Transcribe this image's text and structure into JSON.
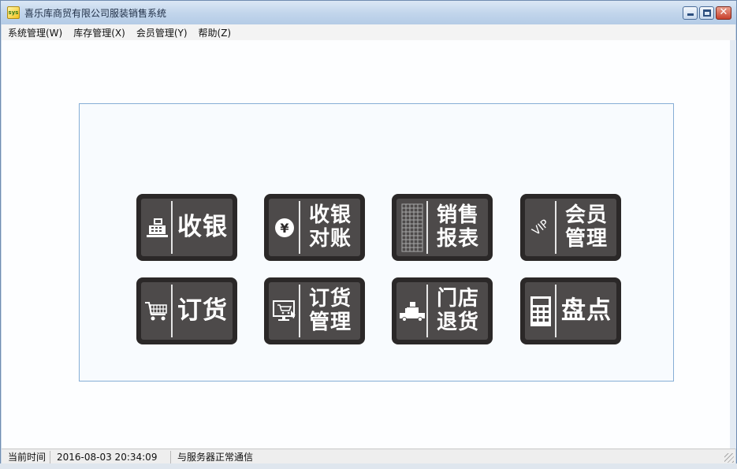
{
  "window": {
    "title": "喜乐库商贸有限公司服装销售系统",
    "app_icon_text": "sys",
    "close_glyph": "✕"
  },
  "menu": {
    "items": [
      {
        "label": "系统管理(W)"
      },
      {
        "label": "库存管理(X)"
      },
      {
        "label": "会员管理(Y)"
      },
      {
        "label": "帮助(Z)"
      }
    ]
  },
  "tiles": [
    {
      "lines": [
        "收银"
      ],
      "icon": "cash-register-icon"
    },
    {
      "lines": [
        "收银",
        "对账"
      ],
      "icon": "yen-coin-icon"
    },
    {
      "lines": [
        "销售",
        "报表"
      ],
      "icon": "grid-report-icon"
    },
    {
      "lines": [
        "会员",
        "管理"
      ],
      "icon": "vip-icon",
      "icon_text": "VIP"
    },
    {
      "lines": [
        "订货"
      ],
      "icon": "shopping-cart-icon"
    },
    {
      "lines": [
        "订货",
        "管理"
      ],
      "icon": "monitor-cart-icon"
    },
    {
      "lines": [
        "门店",
        "退货"
      ],
      "icon": "delivery-truck-icon"
    },
    {
      "lines": [
        "盘点"
      ],
      "icon": "calculator-icon"
    }
  ],
  "coin_symbol": "¥",
  "statusbar": {
    "time_label": "当前时间",
    "time_value": "2016-08-03 20:34:09",
    "server_status": "与服务器正常通信"
  },
  "colors": {
    "tile_outer": "#2b2828",
    "tile_inner": "#4d4a4a",
    "panel_border": "#86aed6",
    "titlebar": "#c3d6ec"
  }
}
